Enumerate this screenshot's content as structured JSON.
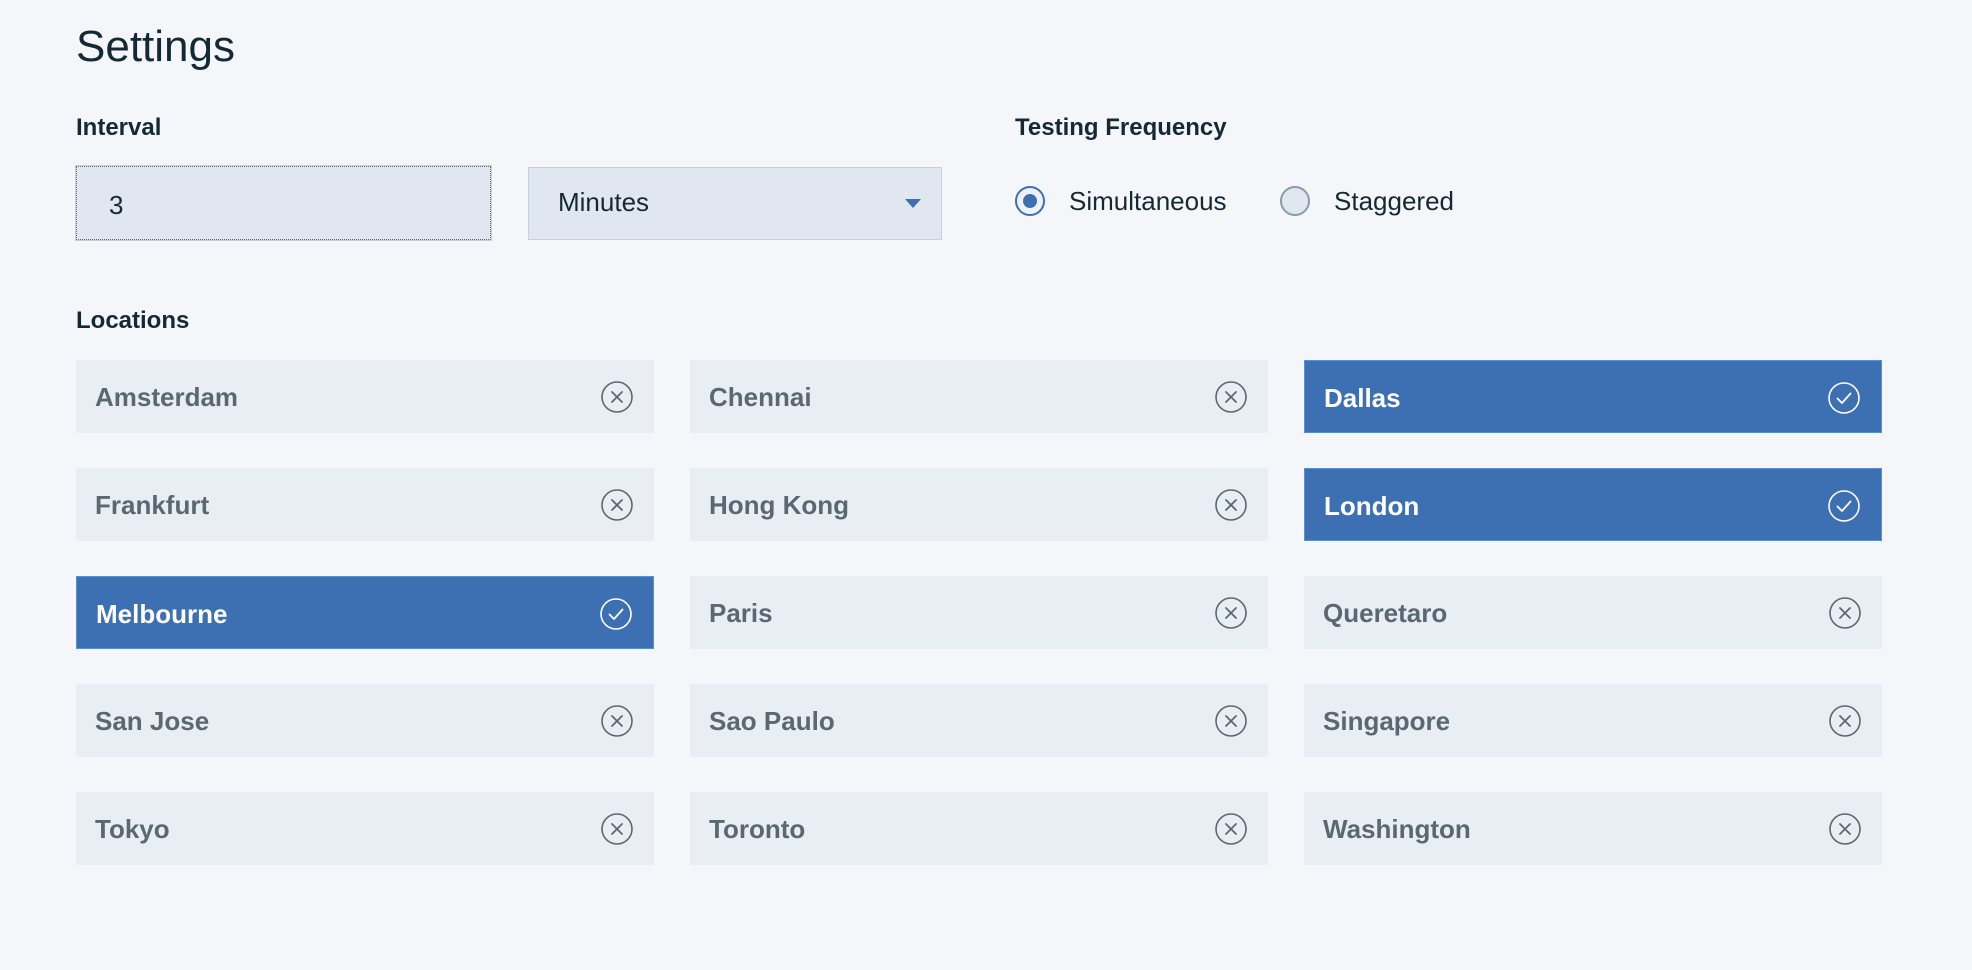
{
  "page": {
    "title": "Settings"
  },
  "interval": {
    "label": "Interval",
    "value": "3",
    "unit": "Minutes"
  },
  "frequency": {
    "label": "Testing Frequency",
    "options": [
      {
        "label": "Simultaneous",
        "checked": true
      },
      {
        "label": "Staggered",
        "checked": false
      }
    ]
  },
  "locations": {
    "label": "Locations",
    "items": [
      {
        "name": "Amsterdam",
        "selected": false
      },
      {
        "name": "Chennai",
        "selected": false
      },
      {
        "name": "Dallas",
        "selected": true
      },
      {
        "name": "Frankfurt",
        "selected": false
      },
      {
        "name": "Hong Kong",
        "selected": false
      },
      {
        "name": "London",
        "selected": true
      },
      {
        "name": "Melbourne",
        "selected": true
      },
      {
        "name": "Paris",
        "selected": false
      },
      {
        "name": "Queretaro",
        "selected": false
      },
      {
        "name": "San Jose",
        "selected": false
      },
      {
        "name": "Sao Paulo",
        "selected": false
      },
      {
        "name": "Singapore",
        "selected": false
      },
      {
        "name": "Tokyo",
        "selected": false
      },
      {
        "name": "Toronto",
        "selected": false
      },
      {
        "name": "Washington",
        "selected": false
      }
    ]
  },
  "icons": {
    "selected": "check-circle-icon",
    "unselected": "close-circle-icon",
    "dropdown": "caret-down-icon"
  },
  "colors": {
    "accent": "#3d70b2",
    "background": "#f4f6fa",
    "tile_background": "#e9eef5",
    "field_background": "#e1e7f0",
    "text_primary": "#152935",
    "text_muted": "#5a6872"
  }
}
